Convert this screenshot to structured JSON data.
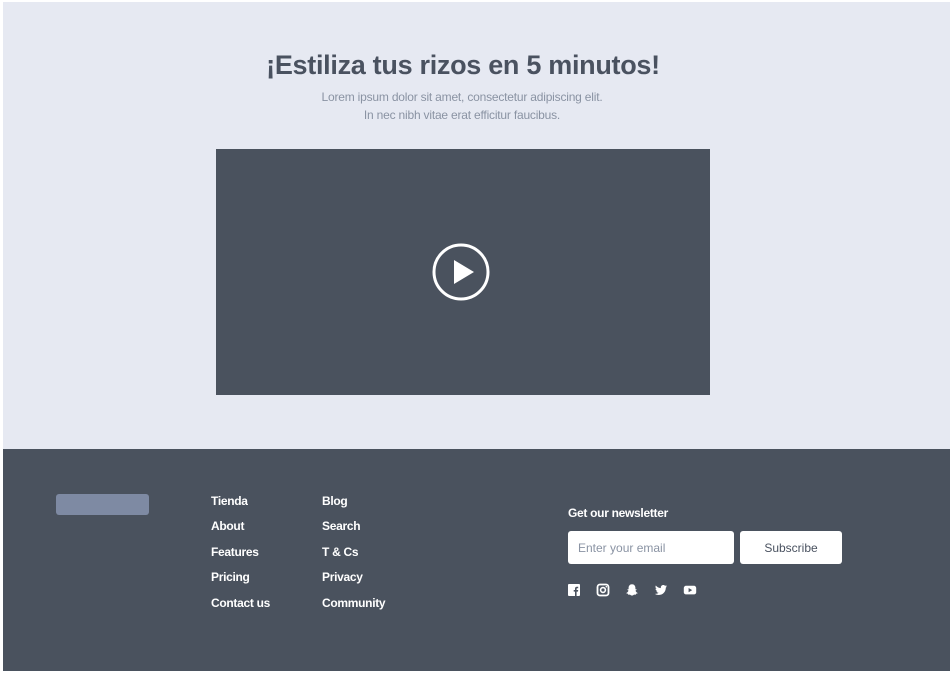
{
  "hero": {
    "title": "¡Estiliza tus rizos en 5 minutos!",
    "subtitle_line1": "Lorem ipsum dolor sit amet, consectetur adipiscing elit.",
    "subtitle_line2": "In nec nibh vitae erat efficitur faucibus.",
    "video_play_icon": "play-circle-icon"
  },
  "footer": {
    "links_col1": [
      "Tienda",
      "About",
      "Features",
      "Pricing",
      "Contact us"
    ],
    "links_col2": [
      "Blog",
      "Search",
      "T & Cs",
      "Privacy",
      "Community"
    ],
    "newsletter_label": "Get our newsletter",
    "email_placeholder": "Enter your email",
    "subscribe_label": "Subscribe",
    "social_icons": [
      "facebook-icon",
      "instagram-icon",
      "snapchat-icon",
      "twitter-icon",
      "youtube-icon"
    ]
  },
  "colors": {
    "hero_background": "#e6e9f2",
    "dark_slate": "#4a525e",
    "logo_placeholder": "#7e8aa3",
    "title_text": "#4a5260",
    "muted_text": "#8a93a3"
  }
}
